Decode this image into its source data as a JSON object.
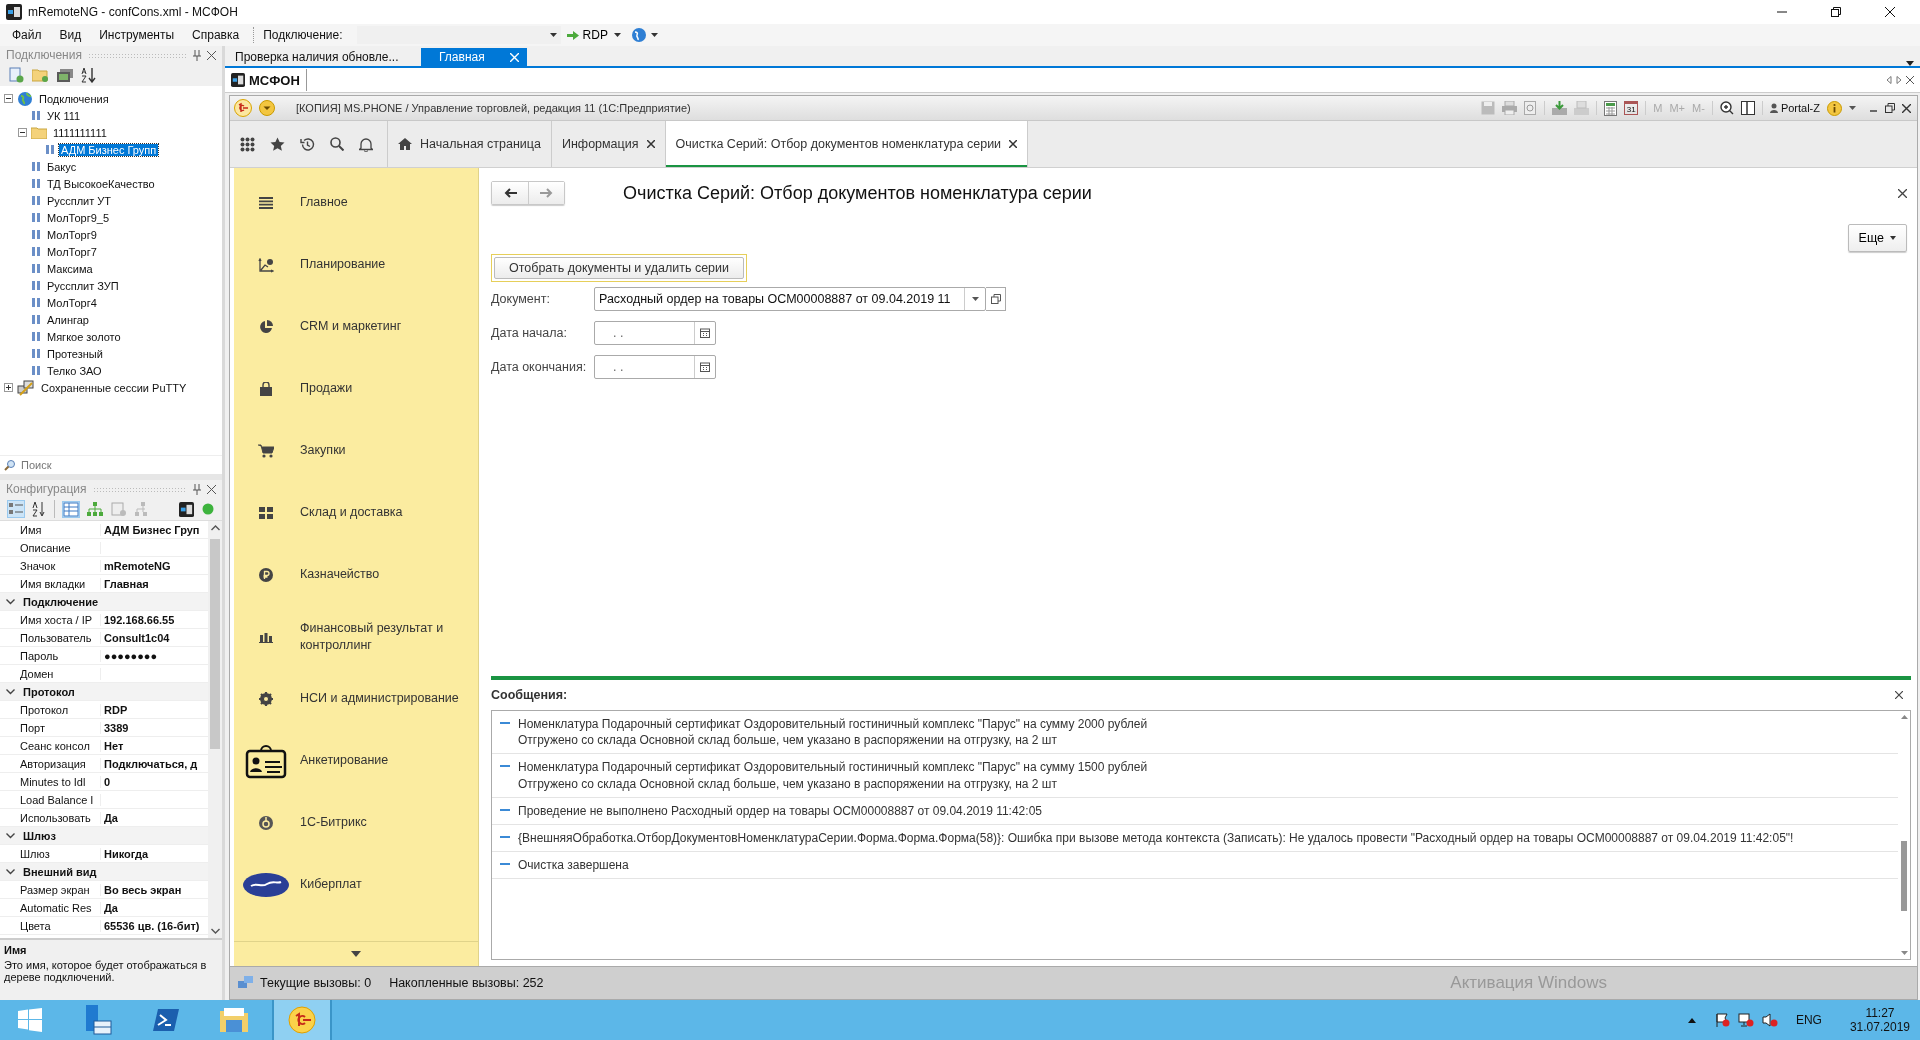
{
  "window": {
    "title": "mRemoteNG - confCons.xml - МСФОН"
  },
  "menu": [
    "Файл",
    "Вид",
    "Инструменты",
    "Справка"
  ],
  "connect_toolbar": {
    "label": "Подключение:",
    "protocol": "RDP"
  },
  "connections_panel": {
    "title": "Подключения",
    "search": {
      "placeholder": "Поиск"
    },
    "tree": [
      {
        "label": "Подключения",
        "kind": "root",
        "expanded": true,
        "selected": false,
        "children": [
          {
            "label": "УК 111",
            "kind": "connection",
            "selected": false
          },
          {
            "label": "1111111111",
            "kind": "folder",
            "expanded": true,
            "selected": false,
            "children": [
              {
                "label": "АДМ Бизнес Групп",
                "kind": "connection",
                "selected": true
              }
            ]
          },
          {
            "label": "Бакус",
            "kind": "connection",
            "selected": false
          },
          {
            "label": "ТД ВысокоеКачество",
            "kind": "connection",
            "selected": false
          },
          {
            "label": "Руссплит УТ",
            "kind": "connection",
            "selected": false
          },
          {
            "label": "МолТорг9_5",
            "kind": "connection",
            "selected": false
          },
          {
            "label": "МолТорг9",
            "kind": "connection",
            "selected": false
          },
          {
            "label": "МолТорг7",
            "kind": "connection",
            "selected": false
          },
          {
            "label": "Максима",
            "kind": "connection",
            "selected": false
          },
          {
            "label": "Руссплит ЗУП",
            "kind": "connection",
            "selected": false
          },
          {
            "label": "МолТорг4",
            "kind": "connection",
            "selected": false
          },
          {
            "label": "Алингар",
            "kind": "connection",
            "selected": false
          },
          {
            "label": "Мягкое золото",
            "kind": "connection",
            "selected": false
          },
          {
            "label": "Протезный",
            "kind": "connection",
            "selected": false
          },
          {
            "label": "Телко ЗАО",
            "kind": "connection",
            "selected": false
          }
        ]
      },
      {
        "label": "Сохраненные сессии PuTTY",
        "kind": "putty",
        "expanded": false,
        "selected": false
      }
    ]
  },
  "config_panel": {
    "title": "Конфигурация",
    "properties": [
      {
        "kind": "row",
        "name": "Имя",
        "value": "АДМ Бизнес Груп"
      },
      {
        "kind": "row",
        "name": "Описание"
      },
      {
        "kind": "row",
        "name": "Значок",
        "value": "mRemoteNG"
      },
      {
        "kind": "row",
        "name": "Имя вкладки",
        "value": "Главная"
      },
      {
        "kind": "group",
        "name": "Подключение",
        "expanded": true
      },
      {
        "kind": "row",
        "name": "Имя хоста / IP",
        "value": "192.168.66.55"
      },
      {
        "kind": "row",
        "name": "Пользователь",
        "value": "Consult1c04"
      },
      {
        "kind": "row",
        "name": "Пароль",
        "value": "●●●●●●●●"
      },
      {
        "kind": "row",
        "name": "Домен"
      },
      {
        "kind": "group",
        "name": "Протокол",
        "expanded": true
      },
      {
        "kind": "row",
        "name": "Протокол",
        "value": "RDP"
      },
      {
        "kind": "row",
        "name": "Порт",
        "value": "3389"
      },
      {
        "kind": "row",
        "name": "Сеанс консол",
        "value": "Нет"
      },
      {
        "kind": "row",
        "name": "Авторизация",
        "value": "Подключаться, д"
      },
      {
        "kind": "row",
        "name": "Minutes to Idl",
        "value": "0"
      },
      {
        "kind": "row",
        "name": "Load Balance I"
      },
      {
        "kind": "row",
        "name": "Использовать",
        "value": "Да"
      },
      {
        "kind": "group",
        "name": "Шлюз",
        "expanded": true
      },
      {
        "kind": "row",
        "name": "Шлюз",
        "value": "Никогда"
      },
      {
        "kind": "group",
        "name": "Внешний вид",
        "expanded": true
      },
      {
        "kind": "row",
        "name": "Размер экран",
        "value": "Во весь экран"
      },
      {
        "kind": "row",
        "name": "Automatic Res",
        "value": "Да"
      },
      {
        "kind": "row",
        "name": "Цвета",
        "value": "65536 цв. (16-бит)"
      }
    ],
    "description": {
      "title": "Имя",
      "text": "Это имя, которое будет отображаться в дереве подключений."
    }
  },
  "doc_tabs": [
    {
      "label": "Проверка наличия обновле...",
      "selected": false,
      "closable": false
    },
    {
      "label": "Главная",
      "selected": true,
      "closable": true
    }
  ],
  "session_tab": "МСФОН",
  "app": {
    "title": "[КОПИЯ] MS.PHONE / Управление торговлей, редакция 11  (1С:Предприятие)",
    "calendar_day": "31",
    "memory_keys": [
      "M",
      "M+",
      "M-"
    ],
    "user": "Portal-Z",
    "tabs": [
      {
        "label": "Начальная страница",
        "kind": "home",
        "selected": false,
        "closable": false
      },
      {
        "label": "Информация",
        "kind": "page",
        "selected": false,
        "closable": true
      },
      {
        "label": "Очистка Серий: Отбор документов номенклатура серии",
        "kind": "page",
        "selected": true,
        "closable": true
      }
    ],
    "sections": [
      {
        "label": "Главное",
        "kind": "menu"
      },
      {
        "label": "Планирование",
        "kind": "planning"
      },
      {
        "label": "CRM и маркетинг",
        "kind": "pie"
      },
      {
        "label": "Продажи",
        "kind": "bag"
      },
      {
        "label": "Закупки",
        "kind": "cart"
      },
      {
        "label": "Склад и доставка",
        "kind": "grid"
      },
      {
        "label": "Казначейство",
        "kind": "ruble"
      },
      {
        "label": "Финансовый результат и контроллинг",
        "kind": "bars"
      },
      {
        "label": "НСИ и администрирование",
        "kind": "gear"
      },
      {
        "label": "Анкетирование",
        "kind": "badge"
      },
      {
        "label": "1С-Битрикс",
        "kind": "swirl"
      },
      {
        "label": "Киберплат",
        "kind": "oval"
      }
    ],
    "form": {
      "title": "Очистка Серий: Отбор документов номенклатура серии",
      "more": "Еще",
      "action": "Отобрать документы и удалить серии",
      "fields": [
        {
          "label": "Документ:",
          "value": "Расходный ордер на товары ОСМ00008887 от 09.04.2019 11",
          "kind": "ref"
        },
        {
          "label": "Дата начала:",
          "value": ".  .",
          "kind": "date"
        },
        {
          "label": "Дата окончания:",
          "value": ".  .",
          "kind": "date"
        }
      ]
    },
    "messages": {
      "title": "Сообщения:",
      "items": [
        {
          "lines": [
            "Номенклатура Подарочный сертификат Оздоровительный гостиничный комплекс \"Парус\" на сумму 2000 рублей",
            "Отгружено со склада Основной склад больше, чем указано в распоряжении на отгрузку, на 2 шт"
          ]
        },
        {
          "lines": [
            "Номенклатура Подарочный сертификат Оздоровительный гостиничный комплекс \"Парус\" на сумму 1500 рублей",
            "Отгружено со склада Основной склад больше, чем указано в распоряжении на отгрузку, на 2 шт"
          ]
        },
        {
          "lines": [
            "Проведение не выполнено Расходный ордер на товары ОСМ00008887 от 09.04.2019 11:42:05"
          ]
        },
        {
          "lines": [
            "{ВнешняяОбработка.ОтборДокументовНоменклатураСерии.Форма.Форма.Форма(58)}: Ошибка при вызове метода контекста (Записать): Не удалось провести \"Расходный ордер на товары ОСМ00008887 от 09.04.2019 11:42:05\"!"
          ]
        },
        {
          "lines": [
            "Очистка завершена"
          ]
        }
      ]
    },
    "status": {
      "current": "Текущие вызовы: 0",
      "accumulated": "Накопленные вызовы: 252"
    }
  },
  "os_notice": "Активация Windows",
  "taskbar": {
    "apps": [
      {
        "kind": "start",
        "selected": false
      },
      {
        "kind": "server",
        "selected": false
      },
      {
        "kind": "shell",
        "selected": false
      },
      {
        "kind": "folder",
        "selected": false
      },
      {
        "kind": "onec",
        "selected": true
      }
    ],
    "lang": "ENG",
    "time": "11:27",
    "date": "31.07.2019"
  }
}
